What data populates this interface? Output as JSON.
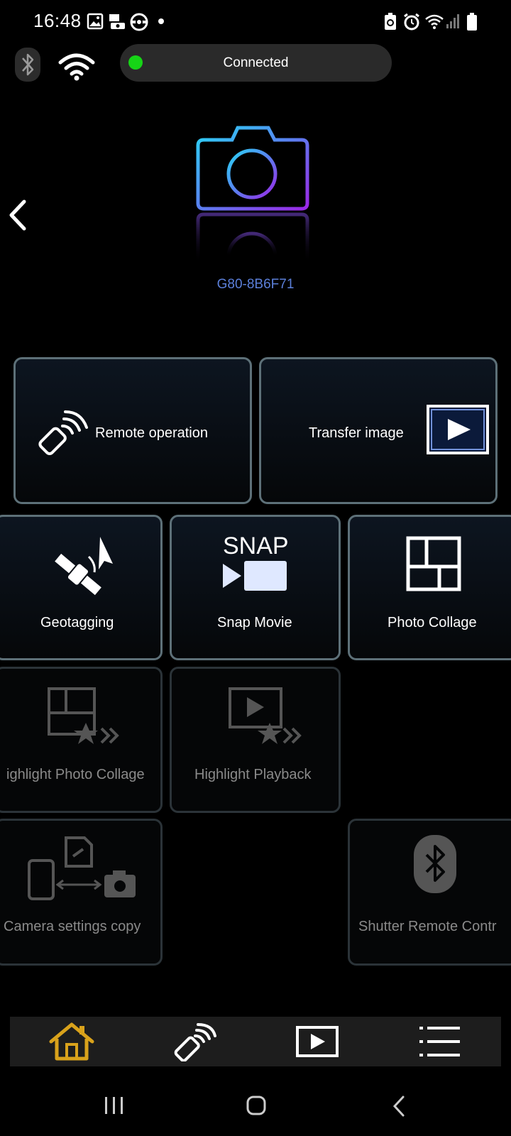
{
  "status_bar": {
    "time": "16:48"
  },
  "header": {
    "connection_status": "Connected",
    "device_name": "G80-8B6F71"
  },
  "colors": {
    "connected": "#16d416",
    "device_name": "#5b7fd9",
    "home_active": "#d9a21b"
  },
  "tiles": {
    "remote_operation": "Remote operation",
    "transfer_image": "Transfer image",
    "geotagging": "Geotagging",
    "snap_movie": "Snap Movie",
    "snap_text": "SNAP",
    "photo_collage": "Photo Collage",
    "highlight_photo_collage": "ighlight Photo Collage",
    "highlight_playback": "Highlight Playback",
    "camera_settings_copy": "Camera settings copy",
    "shutter_remote": "Shutter Remote Contr"
  },
  "tab_bar": {
    "items": [
      {
        "icon": "home-icon",
        "active": true
      },
      {
        "icon": "remote-icon",
        "active": false
      },
      {
        "icon": "playback-icon",
        "active": false
      },
      {
        "icon": "menu-icon",
        "active": false
      }
    ]
  }
}
